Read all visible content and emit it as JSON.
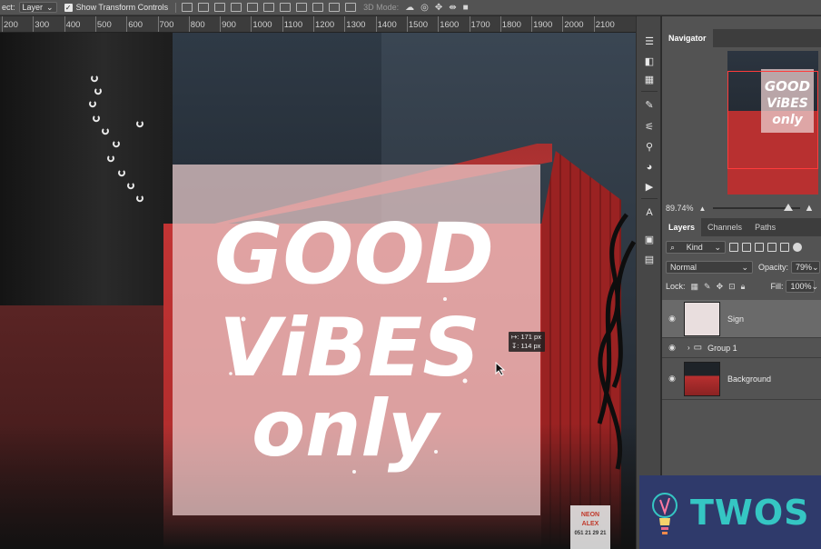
{
  "options_bar": {
    "auto_select_label": "ect:",
    "auto_select_value": "Layer",
    "transform_controls_label": "Show Transform Controls",
    "mode_3d_label": "3D Mode:"
  },
  "ruler": {
    "ticks": [
      "200",
      "300",
      "400",
      "500",
      "600",
      "700",
      "800",
      "900",
      "1000",
      "1100",
      "1200",
      "1300",
      "1400",
      "1500",
      "1600",
      "1700",
      "1800",
      "1900",
      "2000",
      "2100"
    ]
  },
  "canvas": {
    "sign_lines": [
      "GOOD",
      "ViBES",
      "only"
    ],
    "measure_width": "↦: 171 px",
    "measure_height": "↧: 114 px",
    "box_label_lines": [
      "NEON",
      "ALEX",
      "051 21 29 21"
    ]
  },
  "navigator": {
    "tab_label": "Navigator",
    "thumb_text": [
      "GOOD",
      "ViBES",
      "only"
    ],
    "zoom_value": "89.74%"
  },
  "layers_panel": {
    "tabs": [
      "Layers",
      "Channels",
      "Paths"
    ],
    "filter_kind": "Kind",
    "blend_mode": "Normal",
    "opacity_label": "Opacity:",
    "opacity_value": "79%",
    "lock_label": "Lock:",
    "fill_label": "Fill:",
    "fill_value": "100%",
    "layers": [
      {
        "name": "Sign"
      },
      {
        "name": "Group 1"
      },
      {
        "name": "Background"
      }
    ]
  },
  "watermark": {
    "brand": "TWOS"
  },
  "colors": {
    "accent_red": "#c23434",
    "overlay_pink": "#ebcdcd",
    "brand_teal": "#35c6c3",
    "brand_navy": "#2f3a6b"
  }
}
